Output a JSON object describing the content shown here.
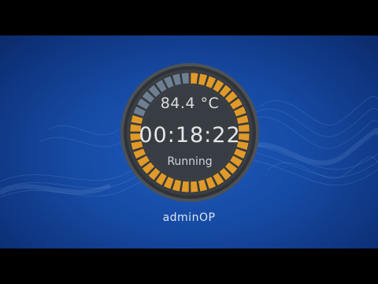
{
  "gauge": {
    "temperature": "84.4 °C",
    "timer": "00:18:22",
    "status": "Running",
    "total_segments": 40,
    "remaining_segments": 8,
    "progress_fraction": 0.8,
    "colors": {
      "progress": "#e09a2a",
      "remaining": "#6f7f92",
      "dial": "#383d43",
      "ring": "#4c5157"
    }
  },
  "user": {
    "name": "adminOP"
  }
}
